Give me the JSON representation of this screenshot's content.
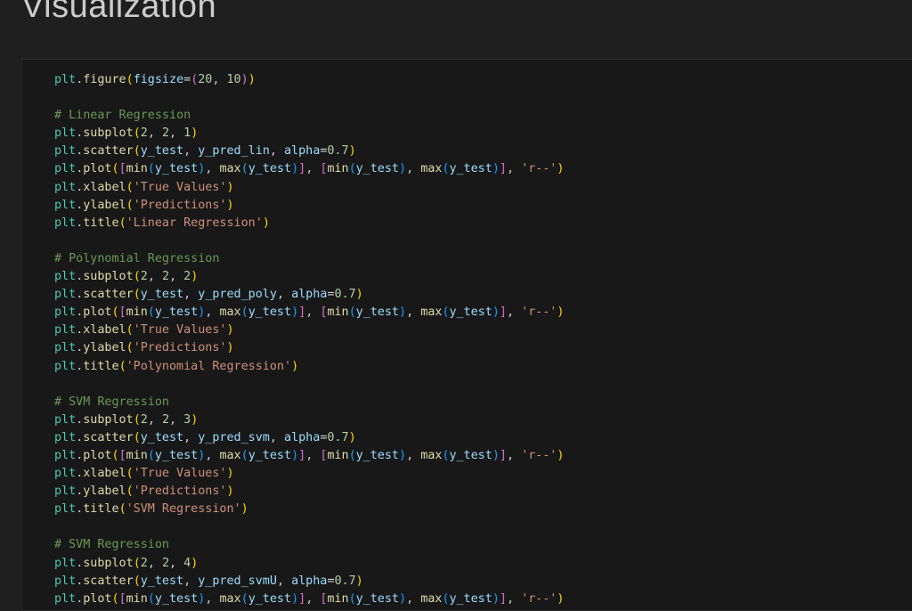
{
  "heading": "Visualization",
  "code": [
    [
      [
        "plt",
        "plt"
      ],
      [
        ".",
        "p"
      ],
      [
        "figure",
        "fn"
      ],
      [
        "(",
        "b1"
      ],
      [
        "figsize",
        "var"
      ],
      [
        "=",
        "op"
      ],
      [
        "(",
        "b2"
      ],
      [
        "20",
        "num"
      ],
      [
        ", ",
        "p"
      ],
      [
        "10",
        "num"
      ],
      [
        ")",
        "b2"
      ],
      [
        ")",
        "b1"
      ]
    ],
    [],
    [
      [
        "# Linear Regression",
        "cm"
      ]
    ],
    [
      [
        "plt",
        "plt"
      ],
      [
        ".",
        "p"
      ],
      [
        "subplot",
        "fn"
      ],
      [
        "(",
        "b1"
      ],
      [
        "2",
        "num"
      ],
      [
        ", ",
        "p"
      ],
      [
        "2",
        "num"
      ],
      [
        ", ",
        "p"
      ],
      [
        "1",
        "num"
      ],
      [
        ")",
        "b1"
      ]
    ],
    [
      [
        "plt",
        "plt"
      ],
      [
        ".",
        "p"
      ],
      [
        "scatter",
        "fn"
      ],
      [
        "(",
        "b1"
      ],
      [
        "y_test",
        "var"
      ],
      [
        ", ",
        "p"
      ],
      [
        "y_pred_lin",
        "var"
      ],
      [
        ", ",
        "p"
      ],
      [
        "alpha",
        "var"
      ],
      [
        "=",
        "op"
      ],
      [
        "0.7",
        "num"
      ],
      [
        ")",
        "b1"
      ]
    ],
    [
      [
        "plt",
        "plt"
      ],
      [
        ".",
        "p"
      ],
      [
        "plot",
        "fn"
      ],
      [
        "(",
        "b1"
      ],
      [
        "[",
        "b2"
      ],
      [
        "min",
        "fn"
      ],
      [
        "(",
        "b3"
      ],
      [
        "y_test",
        "var"
      ],
      [
        ")",
        "b3"
      ],
      [
        ", ",
        "p"
      ],
      [
        "max",
        "fn"
      ],
      [
        "(",
        "b3"
      ],
      [
        "y_test",
        "var"
      ],
      [
        ")",
        "b3"
      ],
      [
        "]",
        "b2"
      ],
      [
        ", ",
        "p"
      ],
      [
        "[",
        "b2"
      ],
      [
        "min",
        "fn"
      ],
      [
        "(",
        "b3"
      ],
      [
        "y_test",
        "var"
      ],
      [
        ")",
        "b3"
      ],
      [
        ", ",
        "p"
      ],
      [
        "max",
        "fn"
      ],
      [
        "(",
        "b3"
      ],
      [
        "y_test",
        "var"
      ],
      [
        ")",
        "b3"
      ],
      [
        "]",
        "b2"
      ],
      [
        ", ",
        "p"
      ],
      [
        "'r--'",
        "str"
      ],
      [
        ")",
        "b1"
      ]
    ],
    [
      [
        "plt",
        "plt"
      ],
      [
        ".",
        "p"
      ],
      [
        "xlabel",
        "fn"
      ],
      [
        "(",
        "b1"
      ],
      [
        "'True Values'",
        "str"
      ],
      [
        ")",
        "b1"
      ]
    ],
    [
      [
        "plt",
        "plt"
      ],
      [
        ".",
        "p"
      ],
      [
        "ylabel",
        "fn"
      ],
      [
        "(",
        "b1"
      ],
      [
        "'Predictions'",
        "str"
      ],
      [
        ")",
        "b1"
      ]
    ],
    [
      [
        "plt",
        "plt"
      ],
      [
        ".",
        "p"
      ],
      [
        "title",
        "fn"
      ],
      [
        "(",
        "b1"
      ],
      [
        "'Linear Regression'",
        "str"
      ],
      [
        ")",
        "b1"
      ]
    ],
    [],
    [
      [
        "# Polynomial Regression",
        "cm"
      ]
    ],
    [
      [
        "plt",
        "plt"
      ],
      [
        ".",
        "p"
      ],
      [
        "subplot",
        "fn"
      ],
      [
        "(",
        "b1"
      ],
      [
        "2",
        "num"
      ],
      [
        ", ",
        "p"
      ],
      [
        "2",
        "num"
      ],
      [
        ", ",
        "p"
      ],
      [
        "2",
        "num"
      ],
      [
        ")",
        "b1"
      ]
    ],
    [
      [
        "plt",
        "plt"
      ],
      [
        ".",
        "p"
      ],
      [
        "scatter",
        "fn"
      ],
      [
        "(",
        "b1"
      ],
      [
        "y_test",
        "var"
      ],
      [
        ", ",
        "p"
      ],
      [
        "y_pred_poly",
        "var"
      ],
      [
        ", ",
        "p"
      ],
      [
        "alpha",
        "var"
      ],
      [
        "=",
        "op"
      ],
      [
        "0.7",
        "num"
      ],
      [
        ")",
        "b1"
      ]
    ],
    [
      [
        "plt",
        "plt"
      ],
      [
        ".",
        "p"
      ],
      [
        "plot",
        "fn"
      ],
      [
        "(",
        "b1"
      ],
      [
        "[",
        "b2"
      ],
      [
        "min",
        "fn"
      ],
      [
        "(",
        "b3"
      ],
      [
        "y_test",
        "var"
      ],
      [
        ")",
        "b3"
      ],
      [
        ", ",
        "p"
      ],
      [
        "max",
        "fn"
      ],
      [
        "(",
        "b3"
      ],
      [
        "y_test",
        "var"
      ],
      [
        ")",
        "b3"
      ],
      [
        "]",
        "b2"
      ],
      [
        ", ",
        "p"
      ],
      [
        "[",
        "b2"
      ],
      [
        "min",
        "fn"
      ],
      [
        "(",
        "b3"
      ],
      [
        "y_test",
        "var"
      ],
      [
        ")",
        "b3"
      ],
      [
        ", ",
        "p"
      ],
      [
        "max",
        "fn"
      ],
      [
        "(",
        "b3"
      ],
      [
        "y_test",
        "var"
      ],
      [
        ")",
        "b3"
      ],
      [
        "]",
        "b2"
      ],
      [
        ", ",
        "p"
      ],
      [
        "'r--'",
        "str"
      ],
      [
        ")",
        "b1"
      ]
    ],
    [
      [
        "plt",
        "plt"
      ],
      [
        ".",
        "p"
      ],
      [
        "xlabel",
        "fn"
      ],
      [
        "(",
        "b1"
      ],
      [
        "'True Values'",
        "str"
      ],
      [
        ")",
        "b1"
      ]
    ],
    [
      [
        "plt",
        "plt"
      ],
      [
        ".",
        "p"
      ],
      [
        "ylabel",
        "fn"
      ],
      [
        "(",
        "b1"
      ],
      [
        "'Predictions'",
        "str"
      ],
      [
        ")",
        "b1"
      ]
    ],
    [
      [
        "plt",
        "plt"
      ],
      [
        ".",
        "p"
      ],
      [
        "title",
        "fn"
      ],
      [
        "(",
        "b1"
      ],
      [
        "'Polynomial Regression'",
        "str"
      ],
      [
        ")",
        "b1"
      ]
    ],
    [],
    [
      [
        "# SVM Regression",
        "cm"
      ]
    ],
    [
      [
        "plt",
        "plt"
      ],
      [
        ".",
        "p"
      ],
      [
        "subplot",
        "fn"
      ],
      [
        "(",
        "b1"
      ],
      [
        "2",
        "num"
      ],
      [
        ", ",
        "p"
      ],
      [
        "2",
        "num"
      ],
      [
        ", ",
        "p"
      ],
      [
        "3",
        "num"
      ],
      [
        ")",
        "b1"
      ]
    ],
    [
      [
        "plt",
        "plt"
      ],
      [
        ".",
        "p"
      ],
      [
        "scatter",
        "fn"
      ],
      [
        "(",
        "b1"
      ],
      [
        "y_test",
        "var"
      ],
      [
        ", ",
        "p"
      ],
      [
        "y_pred_svm",
        "var"
      ],
      [
        ", ",
        "p"
      ],
      [
        "alpha",
        "var"
      ],
      [
        "=",
        "op"
      ],
      [
        "0.7",
        "num"
      ],
      [
        ")",
        "b1"
      ]
    ],
    [
      [
        "plt",
        "plt"
      ],
      [
        ".",
        "p"
      ],
      [
        "plot",
        "fn"
      ],
      [
        "(",
        "b1"
      ],
      [
        "[",
        "b2"
      ],
      [
        "min",
        "fn"
      ],
      [
        "(",
        "b3"
      ],
      [
        "y_test",
        "var"
      ],
      [
        ")",
        "b3"
      ],
      [
        ", ",
        "p"
      ],
      [
        "max",
        "fn"
      ],
      [
        "(",
        "b3"
      ],
      [
        "y_test",
        "var"
      ],
      [
        ")",
        "b3"
      ],
      [
        "]",
        "b2"
      ],
      [
        ", ",
        "p"
      ],
      [
        "[",
        "b2"
      ],
      [
        "min",
        "fn"
      ],
      [
        "(",
        "b3"
      ],
      [
        "y_test",
        "var"
      ],
      [
        ")",
        "b3"
      ],
      [
        ", ",
        "p"
      ],
      [
        "max",
        "fn"
      ],
      [
        "(",
        "b3"
      ],
      [
        "y_test",
        "var"
      ],
      [
        ")",
        "b3"
      ],
      [
        "]",
        "b2"
      ],
      [
        ", ",
        "p"
      ],
      [
        "'r--'",
        "str"
      ],
      [
        ")",
        "b1"
      ]
    ],
    [
      [
        "plt",
        "plt"
      ],
      [
        ".",
        "p"
      ],
      [
        "xlabel",
        "fn"
      ],
      [
        "(",
        "b1"
      ],
      [
        "'True Values'",
        "str"
      ],
      [
        ")",
        "b1"
      ]
    ],
    [
      [
        "plt",
        "plt"
      ],
      [
        ".",
        "p"
      ],
      [
        "ylabel",
        "fn"
      ],
      [
        "(",
        "b1"
      ],
      [
        "'Predictions'",
        "str"
      ],
      [
        ")",
        "b1"
      ]
    ],
    [
      [
        "plt",
        "plt"
      ],
      [
        ".",
        "p"
      ],
      [
        "title",
        "fn"
      ],
      [
        "(",
        "b1"
      ],
      [
        "'SVM Regression'",
        "str"
      ],
      [
        ")",
        "b1"
      ]
    ],
    [],
    [
      [
        "# SVM Regression",
        "cm"
      ]
    ],
    [
      [
        "plt",
        "plt"
      ],
      [
        ".",
        "p"
      ],
      [
        "subplot",
        "fn"
      ],
      [
        "(",
        "b1"
      ],
      [
        "2",
        "num"
      ],
      [
        ", ",
        "p"
      ],
      [
        "2",
        "num"
      ],
      [
        ", ",
        "p"
      ],
      [
        "4",
        "num"
      ],
      [
        ")",
        "b1"
      ]
    ],
    [
      [
        "plt",
        "plt"
      ],
      [
        ".",
        "p"
      ],
      [
        "scatter",
        "fn"
      ],
      [
        "(",
        "b1"
      ],
      [
        "y_test",
        "var"
      ],
      [
        ", ",
        "p"
      ],
      [
        "y_pred_svmU",
        "var"
      ],
      [
        ", ",
        "p"
      ],
      [
        "alpha",
        "var"
      ],
      [
        "=",
        "op"
      ],
      [
        "0.7",
        "num"
      ],
      [
        ")",
        "b1"
      ]
    ],
    [
      [
        "plt",
        "plt"
      ],
      [
        ".",
        "p"
      ],
      [
        "plot",
        "fn"
      ],
      [
        "(",
        "b1"
      ],
      [
        "[",
        "b2"
      ],
      [
        "min",
        "fn"
      ],
      [
        "(",
        "b3"
      ],
      [
        "y_test",
        "var"
      ],
      [
        ")",
        "b3"
      ],
      [
        ", ",
        "p"
      ],
      [
        "max",
        "fn"
      ],
      [
        "(",
        "b3"
      ],
      [
        "y_test",
        "var"
      ],
      [
        ")",
        "b3"
      ],
      [
        "]",
        "b2"
      ],
      [
        ", ",
        "p"
      ],
      [
        "[",
        "b2"
      ],
      [
        "min",
        "fn"
      ],
      [
        "(",
        "b3"
      ],
      [
        "y_test",
        "var"
      ],
      [
        ")",
        "b3"
      ],
      [
        ", ",
        "p"
      ],
      [
        "max",
        "fn"
      ],
      [
        "(",
        "b3"
      ],
      [
        "y_test",
        "var"
      ],
      [
        ")",
        "b3"
      ],
      [
        "]",
        "b2"
      ],
      [
        ", ",
        "p"
      ],
      [
        "'r--'",
        "str"
      ],
      [
        ")",
        "b1"
      ]
    ]
  ]
}
